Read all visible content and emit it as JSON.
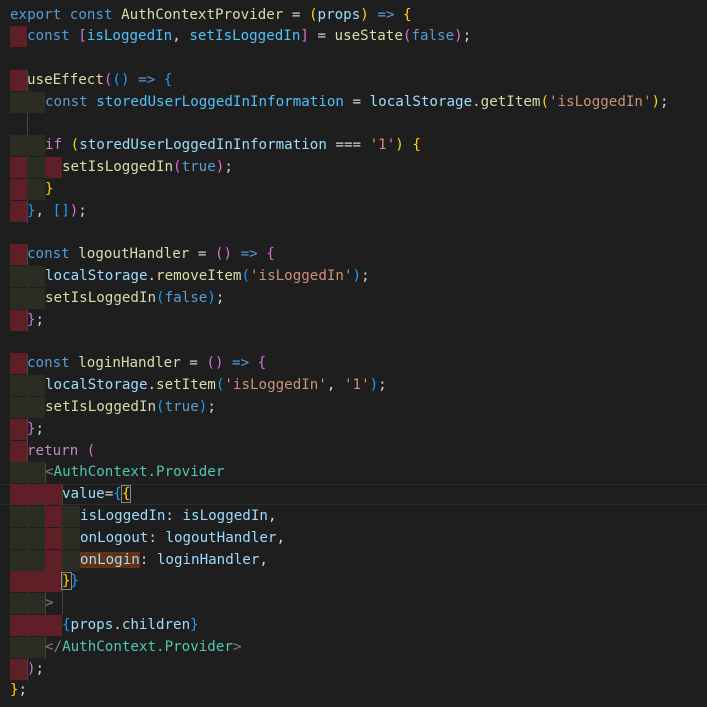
{
  "editor": {
    "language": "javascript-react",
    "lines": [
      {
        "tokens": [
          [
            "kw",
            "export"
          ],
          [
            "txt",
            " "
          ],
          [
            "kw",
            "const"
          ],
          [
            "txt",
            " "
          ],
          [
            "fn",
            "AuthContextProvider"
          ],
          [
            "txt",
            " = "
          ],
          [
            "b1",
            "("
          ],
          [
            "var",
            "props"
          ],
          [
            "b1",
            ")"
          ],
          [
            "txt",
            " "
          ],
          [
            "kw",
            "=>"
          ],
          [
            "txt",
            " "
          ],
          [
            "b1",
            "{"
          ]
        ]
      },
      {
        "tokens": [
          [
            "kw",
            "const"
          ],
          [
            "txt",
            " "
          ],
          [
            "b2",
            "["
          ],
          [
            "cst",
            "isLoggedIn"
          ],
          [
            "txt",
            ", "
          ],
          [
            "cst",
            "setIsLoggedIn"
          ],
          [
            "b2",
            "]"
          ],
          [
            "txt",
            " = "
          ],
          [
            "fn",
            "useState"
          ],
          [
            "b2",
            "("
          ],
          [
            "kw",
            "false"
          ],
          [
            "b2",
            ")"
          ],
          [
            "txt",
            ";"
          ]
        ]
      },
      {
        "tokens": []
      },
      {
        "tokens": [
          [
            "fn",
            "useEffect"
          ],
          [
            "b2",
            "("
          ],
          [
            "b3",
            "("
          ],
          [
            "b3",
            ")"
          ],
          [
            "txt",
            " "
          ],
          [
            "kw",
            "=>"
          ],
          [
            "txt",
            " "
          ],
          [
            "b3",
            "{"
          ]
        ]
      },
      {
        "tokens": [
          [
            "kw",
            "const"
          ],
          [
            "txt",
            " "
          ],
          [
            "cst",
            "storedUserLoggedInInformation"
          ],
          [
            "txt",
            " = "
          ],
          [
            "var",
            "localStorage"
          ],
          [
            "txt",
            "."
          ],
          [
            "fn",
            "getItem"
          ],
          [
            "b1",
            "("
          ],
          [
            "str",
            "'isLoggedIn'"
          ],
          [
            "b1",
            ")"
          ],
          [
            "txt",
            ";"
          ]
        ]
      },
      {
        "tokens": []
      },
      {
        "tokens": [
          [
            "ctl",
            "if"
          ],
          [
            "txt",
            " "
          ],
          [
            "b1",
            "("
          ],
          [
            "var",
            "storedUserLoggedInInformation"
          ],
          [
            "txt",
            " === "
          ],
          [
            "str",
            "'1'"
          ],
          [
            "b1",
            ")"
          ],
          [
            "txt",
            " "
          ],
          [
            "b1",
            "{"
          ]
        ]
      },
      {
        "tokens": [
          [
            "fn",
            "setIsLoggedIn"
          ],
          [
            "b2",
            "("
          ],
          [
            "kw",
            "true"
          ],
          [
            "b2",
            ")"
          ],
          [
            "txt",
            ";"
          ]
        ]
      },
      {
        "tokens": [
          [
            "b1",
            "}"
          ]
        ]
      },
      {
        "tokens": [
          [
            "b3",
            "}"
          ],
          [
            "txt",
            ", "
          ],
          [
            "b3",
            "["
          ],
          [
            "b3",
            "]"
          ],
          [
            "b2",
            ")"
          ],
          [
            "txt",
            ";"
          ]
        ]
      },
      {
        "tokens": []
      },
      {
        "tokens": [
          [
            "kw",
            "const"
          ],
          [
            "txt",
            " "
          ],
          [
            "fn",
            "logoutHandler"
          ],
          [
            "txt",
            " = "
          ],
          [
            "b2",
            "("
          ],
          [
            "b2",
            ")"
          ],
          [
            "txt",
            " "
          ],
          [
            "kw",
            "=>"
          ],
          [
            "txt",
            " "
          ],
          [
            "b2",
            "{"
          ]
        ]
      },
      {
        "tokens": [
          [
            "var",
            "localStorage"
          ],
          [
            "txt",
            "."
          ],
          [
            "fn",
            "removeItem"
          ],
          [
            "b3",
            "("
          ],
          [
            "str",
            "'isLoggedIn'"
          ],
          [
            "b3",
            ")"
          ],
          [
            "txt",
            ";"
          ]
        ]
      },
      {
        "tokens": [
          [
            "fn",
            "setIsLoggedIn"
          ],
          [
            "b3",
            "("
          ],
          [
            "kw",
            "false"
          ],
          [
            "b3",
            ")"
          ],
          [
            "txt",
            ";"
          ]
        ]
      },
      {
        "tokens": [
          [
            "b2",
            "}"
          ],
          [
            "txt",
            ";"
          ]
        ]
      },
      {
        "tokens": []
      },
      {
        "tokens": [
          [
            "kw",
            "const"
          ],
          [
            "txt",
            " "
          ],
          [
            "fn",
            "loginHandler"
          ],
          [
            "txt",
            " = "
          ],
          [
            "b2",
            "("
          ],
          [
            "b2",
            ")"
          ],
          [
            "txt",
            " "
          ],
          [
            "kw",
            "=>"
          ],
          [
            "txt",
            " "
          ],
          [
            "b2",
            "{"
          ]
        ]
      },
      {
        "tokens": [
          [
            "var",
            "localStorage"
          ],
          [
            "txt",
            "."
          ],
          [
            "fn",
            "setItem"
          ],
          [
            "b3",
            "("
          ],
          [
            "str",
            "'isLoggedIn'"
          ],
          [
            "txt",
            ", "
          ],
          [
            "str",
            "'1'"
          ],
          [
            "b3",
            ")"
          ],
          [
            "txt",
            ";"
          ]
        ]
      },
      {
        "tokens": [
          [
            "fn",
            "setIsLoggedIn"
          ],
          [
            "b3",
            "("
          ],
          [
            "kw",
            "true"
          ],
          [
            "b3",
            ")"
          ],
          [
            "txt",
            ";"
          ]
        ]
      },
      {
        "tokens": [
          [
            "b2",
            "}"
          ],
          [
            "txt",
            ";"
          ]
        ]
      },
      {
        "tokens": [
          [
            "ctl",
            "return"
          ],
          [
            "txt",
            " "
          ],
          [
            "b2",
            "("
          ]
        ]
      },
      {
        "tokens": [
          [
            "ang",
            "<"
          ],
          [
            "tag",
            "AuthContext.Provider"
          ]
        ]
      },
      {
        "tokens": [
          [
            "var",
            "value"
          ],
          [
            "txt",
            "="
          ],
          [
            "b3",
            "{"
          ],
          [
            "b1",
            "{"
          ]
        ]
      },
      {
        "tokens": [
          [
            "var",
            "isLoggedIn"
          ],
          [
            "txt",
            ": "
          ],
          [
            "var",
            "isLoggedIn"
          ],
          [
            "txt",
            ","
          ]
        ]
      },
      {
        "tokens": [
          [
            "var",
            "onLogout"
          ],
          [
            "txt",
            ": "
          ],
          [
            "var",
            "logoutHandler"
          ],
          [
            "txt",
            ","
          ]
        ]
      },
      {
        "tokens": [
          [
            "var",
            "onLogin"
          ],
          [
            "txt",
            ": "
          ],
          [
            "var",
            "loginHandler"
          ],
          [
            "txt",
            ","
          ]
        ]
      },
      {
        "tokens": [
          [
            "b1",
            "}"
          ],
          [
            "b3",
            "}"
          ]
        ]
      },
      {
        "tokens": [
          [
            "ang",
            ">"
          ]
        ]
      },
      {
        "tokens": [
          [
            "b3",
            "{"
          ],
          [
            "var",
            "props"
          ],
          [
            "txt",
            "."
          ],
          [
            "var",
            "children"
          ],
          [
            "b3",
            "}"
          ]
        ]
      },
      {
        "tokens": [
          [
            "ang",
            "</"
          ],
          [
            "tag",
            "AuthContext.Provider"
          ],
          [
            "ang",
            ">"
          ]
        ]
      },
      {
        "tokens": [
          [
            "b2",
            ")"
          ],
          [
            "txt",
            ";"
          ]
        ]
      },
      {
        "tokens": [
          [
            "b1",
            "}"
          ],
          [
            "txt",
            ";"
          ]
        ]
      }
    ]
  },
  "theme": {
    "background": "#1e1e1e",
    "keyword": "#569cd6",
    "function": "#dcdcaa",
    "variable": "#9cdcfe",
    "constant": "#4fc1ff",
    "string": "#ce9178",
    "tag": "#4ec9b0",
    "whitespace_error": "#5f1f26"
  }
}
